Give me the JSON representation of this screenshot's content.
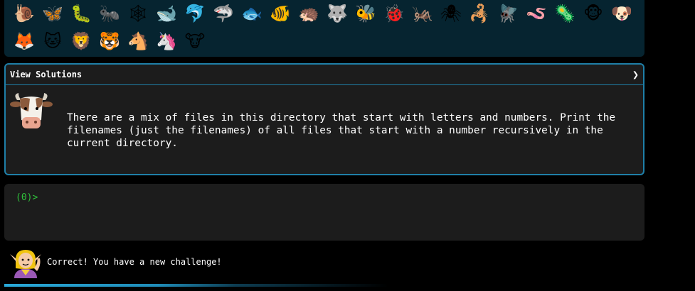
{
  "gallery": {
    "row1": [
      {
        "icon": "snail-icon",
        "glyph": "🐌"
      },
      {
        "icon": "butterfly-icon",
        "glyph": "🦋"
      },
      {
        "icon": "caterpillar-icon",
        "glyph": "🐛"
      },
      {
        "icon": "ant-icon",
        "glyph": "🐜"
      },
      {
        "icon": "spider-web-icon",
        "glyph": "🕸"
      },
      {
        "icon": "whale-icon",
        "glyph": "🐋"
      },
      {
        "icon": "dolphin-icon",
        "glyph": "🐬"
      },
      {
        "icon": "shark-icon",
        "glyph": "🦈"
      },
      {
        "icon": "fish-icon",
        "glyph": "🐟"
      },
      {
        "icon": "tropical-fish-icon",
        "glyph": "🐠"
      },
      {
        "icon": "hedgehog-icon",
        "glyph": "🦔"
      },
      {
        "icon": "wolf-icon",
        "glyph": "🐺"
      },
      {
        "icon": "bee-icon",
        "glyph": "🐝"
      },
      {
        "icon": "ladybug-icon",
        "glyph": "🐞"
      },
      {
        "icon": "cricket-icon",
        "glyph": "🦗"
      },
      {
        "icon": "spider-icon",
        "glyph": "🕷"
      },
      {
        "icon": "scorpion-icon",
        "glyph": "🦂"
      },
      {
        "icon": "fly-icon",
        "glyph": "🪰"
      },
      {
        "icon": "worm-icon",
        "glyph": "🪱"
      },
      {
        "icon": "microbe-icon",
        "glyph": "🦠"
      },
      {
        "icon": "monkey-icon",
        "glyph": "🐵"
      },
      {
        "icon": "dog-icon",
        "glyph": "🐶"
      }
    ],
    "row2": [
      {
        "icon": "fox-icon",
        "glyph": "🦊"
      },
      {
        "icon": "cat-icon",
        "glyph": "🐱"
      },
      {
        "icon": "lion-icon",
        "glyph": "🦁"
      },
      {
        "icon": "tiger-icon",
        "glyph": "🐯"
      },
      {
        "icon": "horse-icon",
        "glyph": "🐴"
      },
      {
        "icon": "unicorn-icon",
        "glyph": "🦄"
      },
      {
        "icon": "cow-icon",
        "glyph": "🐮"
      }
    ]
  },
  "challenge": {
    "header_label": "View Solutions",
    "chevron": "❯",
    "avatar": "cow-icon",
    "text": "There are a mix of files in this directory that start with letters and numbers. Print the filenames (just the filenames) of all files that start with a number recursively in the current directory."
  },
  "terminal": {
    "prompt": "(0)>"
  },
  "status": {
    "avatar": "elf-icon",
    "message": "Correct! You have a new challenge!"
  },
  "progress": {
    "fraction": 0.6
  },
  "colors": {
    "gallery_bg": "#062430",
    "panel_bg": "#1c1c1c",
    "accent": "#1f7fa8",
    "prompt_green": "#2fbf3b"
  }
}
